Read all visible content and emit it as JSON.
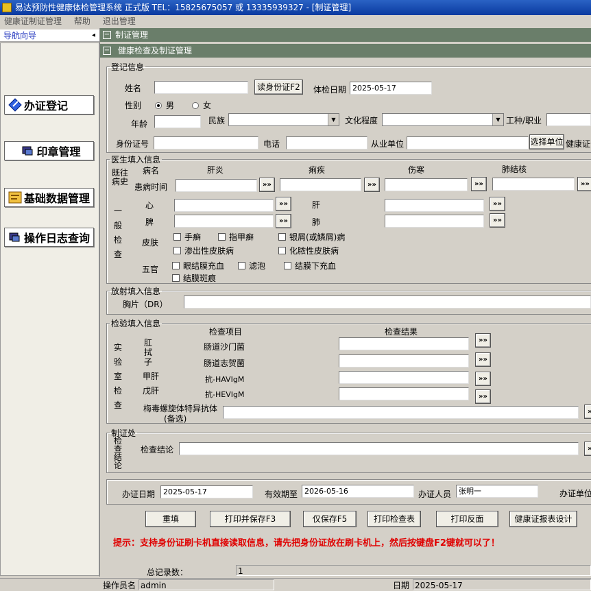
{
  "window": {
    "title": "易达预防性健康体检管理系统 正式版 TEL：15825675057 或 13335939327 - [制证管理]"
  },
  "menu": [
    "健康证制证管理",
    "帮助",
    "退出管理"
  ],
  "nav": {
    "header": "导航向导",
    "pin": "◂",
    "items": [
      "办证登记",
      "印章管理",
      "基础数据管理",
      "操作日志查询"
    ]
  },
  "tab": {
    "title": "制证管理"
  },
  "panel": {
    "title": "健康检查及制证管理"
  },
  "reg": {
    "legend": "登记信息",
    "name_label": "姓名",
    "name_value": "",
    "read_id_button": "读身份证F2",
    "exam_date_label": "体检日期",
    "exam_date": "2025-05-17",
    "gender_label": "性别",
    "gender_male": "男",
    "gender_female": "女",
    "age_label": "年龄",
    "ethnic_label": "民族",
    "edu_label": "文化程度",
    "job_label": "工种/职业",
    "id_label": "身份证号",
    "phone_label": "电话",
    "employer_label": "从业单位",
    "choose_unit_button": "选择单位",
    "health_cert_label": "健康证号"
  },
  "doctor": {
    "legend": "医生填入信息",
    "history_label": "既往病史",
    "disease_label": "病名",
    "diseases": [
      "肝炎",
      "痢疾",
      "伤寒",
      "肺结核"
    ],
    "onset_label": "患病时间",
    "more": "»»",
    "general_label": "一般检查",
    "heart": "心",
    "liver": "肝",
    "spleen": "脾",
    "lung": "肺",
    "skin_label": "皮肤",
    "skin_items": [
      "手癣",
      "指甲癣",
      "银屑(或鳞屑)病",
      "渗出性皮肤病",
      "化脓性皮肤病"
    ],
    "facial_label": "五官",
    "facial_items": [
      "眼结膜充血",
      "滤泡",
      "结膜下充血",
      "结膜斑痕"
    ]
  },
  "xray": {
    "legend": "放射填入信息",
    "chest_label": "胸片（DR）"
  },
  "lab": {
    "legend": "检验填入信息",
    "lab_label": "实验室检查",
    "item_header": "检查项目",
    "result_header": "检查结果",
    "swab_label": "肛拭子",
    "hepA_label": "甲肝",
    "hepE_label": "戊肝",
    "items": [
      "肠道沙门菌",
      "肠道志贺菌",
      "抗-HAVIgM",
      "抗-HEVIgM"
    ],
    "syphilis_label": "梅毒螺旋体特异抗体",
    "syphilis_note": "(备选)"
  },
  "cert": {
    "legend": "制证处",
    "conclusion_vert": "检查结论",
    "conclusion_label": "检查结论"
  },
  "issue": {
    "date_label": "办证日期",
    "date": "2025-05-17",
    "valid_label": "有效期至",
    "valid": "2026-05-16",
    "officer_label": "办证人员",
    "officer": "张明一",
    "unit_label": "办证单位"
  },
  "actions": [
    "重填",
    "打印并保存F3",
    "仅保存F5",
    "打印检查表",
    "打印反面",
    "健康证报表设计"
  ],
  "hint": "提示：支持身份证刷卡机直接读取信息，请先把身份证放在刷卡机上，然后按键盘F2键就可以了！",
  "status": {
    "total_label": "总记录数：",
    "total": "1",
    "operator_label": "操作员名",
    "operator": "admin",
    "date_label": "日期",
    "date": "2025-05-17"
  }
}
